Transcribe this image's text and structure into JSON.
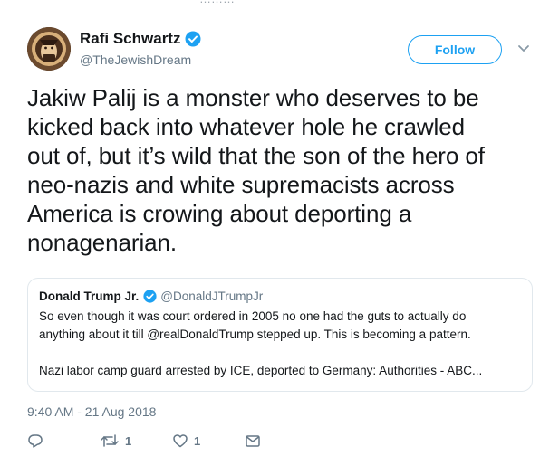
{
  "tweet": {
    "author": {
      "display_name": "Rafi Schwartz",
      "handle": "@TheJewishDream",
      "verified": true
    },
    "follow_label": "Follow",
    "text_lines": [
      "Jakiw Palij is a monster who deserves to be",
      "kicked back into whatever hole he crawled",
      "out of, but it’s wild that the son of the hero of",
      "neo-nazis and white supremacists across",
      "America is crowing about deporting a",
      "nonagenarian."
    ],
    "timestamp": "9:40 AM - 21 Aug 2018",
    "actions": {
      "reply_icon": "reply-icon",
      "retweet_icon": "retweet-icon",
      "retweet_count": "1",
      "like_icon": "heart-icon",
      "like_count": "1",
      "message_icon": "envelope-icon"
    }
  },
  "quoted_tweet": {
    "display_name": "Donald Trump Jr.",
    "handle": "@DonaldJTrumpJr",
    "verified": true,
    "body_lines": [
      "So even though it was court ordered in 2005 no one had the guts to actually do",
      "anything about it till @realDonaldTrump stepped up. This is becoming a pattern."
    ],
    "link_preview": "Nazi labor camp guard arrested by ICE, deported to Germany: Authorities - ABC..."
  },
  "colors": {
    "accent": "#1da1f2",
    "secondary_text": "#657786",
    "border": "#e1e8ed"
  }
}
